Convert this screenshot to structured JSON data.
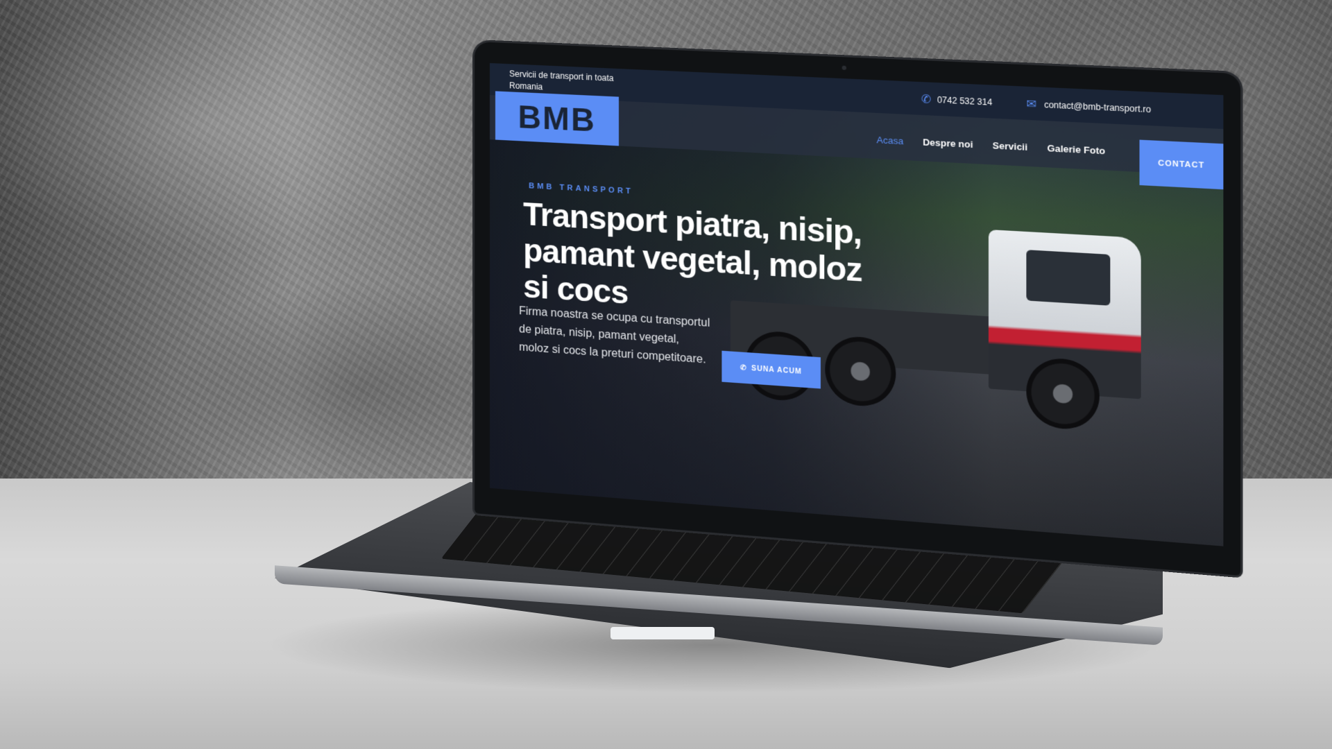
{
  "site": {
    "tagline": "Servicii de transport in toata Romania",
    "phone": "0742 532 314",
    "email": "contact@bmb-transport.ro",
    "logo_text": "BMB",
    "nav": [
      {
        "label": "Acasa",
        "active": true
      },
      {
        "label": "Despre noi",
        "active": false
      },
      {
        "label": "Servicii",
        "active": false
      },
      {
        "label": "Galerie Foto",
        "active": false
      }
    ],
    "contact_label": "CONTACT",
    "hero": {
      "eyebrow": "BMB TRANSPORT",
      "headline": "Transport piatra, nisip, pamant vegetal, moloz si cocs",
      "lead": "Firma noastra se ocupa cu transportul de piatra, nisip, pamant vegetal, moloz si cocs la preturi competitoare.",
      "cta_label": "SUNA ACUM"
    },
    "icons": {
      "phone": "phone-icon",
      "email": "envelope-icon"
    },
    "colors": {
      "accent": "#5b8df5",
      "topbar": "#1a2436"
    }
  }
}
